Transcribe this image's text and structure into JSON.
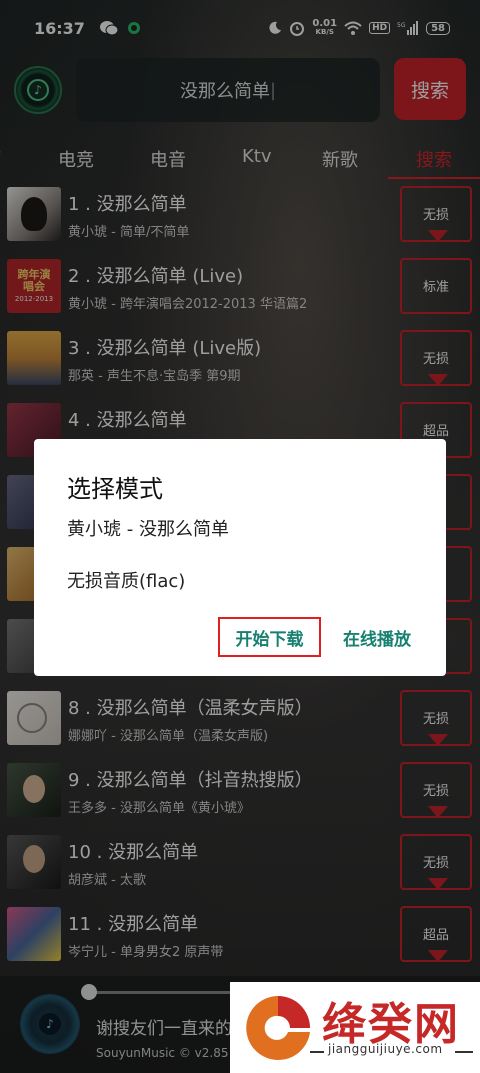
{
  "status_bar": {
    "time": "16:37",
    "net_speed_value": "0.01",
    "net_speed_unit": "KB/S",
    "hd": "HD",
    "signal": "5G",
    "battery": "58"
  },
  "header": {
    "search_value": "没那么简单",
    "search_button": "搜索"
  },
  "tabs": [
    {
      "label": "电竞"
    },
    {
      "label": "电音"
    },
    {
      "label": "Ktv"
    },
    {
      "label": "新歌"
    },
    {
      "label": "搜索",
      "active": true
    }
  ],
  "songs": [
    {
      "title": "1 . 没那么简单",
      "sub": "黄小琥 - 简单/不简单",
      "quality": "无损",
      "cover_color": "#8a8580"
    },
    {
      "title": "2 . 没那么简单 (Live)",
      "sub": "黄小琥 - 跨年演唱会2012-2013 华语篇2",
      "quality": "标准",
      "cover_color": "#b8262a",
      "cover_text": "跨年演唱会",
      "cover_year": "2012-2013"
    },
    {
      "title": "3 . 没那么简单 (Live版)",
      "sub": "那英 - 声生不息·宝岛季 第9期",
      "quality": "无损",
      "cover_color": "#c98a3a"
    },
    {
      "title": "4 . 没那么简单",
      "sub": "",
      "quality": "超品",
      "cover_color": "#7a2a3a"
    },
    {
      "title": "",
      "sub": "",
      "quality": "",
      "cover_color": "#4a4e6a"
    },
    {
      "title": "",
      "sub": "",
      "quality": "",
      "cover_color": "#b57a2a"
    },
    {
      "title": "",
      "sub": "",
      "quality": "",
      "cover_color": "#5a5a5a"
    },
    {
      "title": "8 . 没那么简单（温柔女声版）",
      "sub": "娜娜吖 - 没那么简单（温柔女声版)",
      "quality": "无损",
      "cover_color": "#d8d4cf"
    },
    {
      "title": "9 . 没那么简单（抖音热搜版）",
      "sub": "王多多 - 没那么简单《黄小琥》",
      "quality": "无损",
      "cover_color": "#2e3a30"
    },
    {
      "title": "10 . 没那么简单",
      "sub": "胡彦斌 - 太歌",
      "quality": "无损",
      "cover_color": "#3a3a3a"
    },
    {
      "title": "11 . 没那么简单",
      "sub": "岑宁儿 - 单身男女2 原声带",
      "quality": "超品",
      "cover_color": "#4a6aa0"
    }
  ],
  "dialog": {
    "title": "选择模式",
    "song": "黄小琥 - 没那么简单",
    "quality": "无损音质(flac)",
    "start_download": "开始下载",
    "play_online": "在线播放"
  },
  "player": {
    "marquee": "谢搜友们一直来的",
    "version": "SouyunMusic © v2.85"
  },
  "watermark": {
    "name": "绛癸网",
    "url": "jiangguijiuye.com"
  },
  "colors": {
    "accent_red": "#c9252b",
    "dialog_button_text": "#178070"
  }
}
